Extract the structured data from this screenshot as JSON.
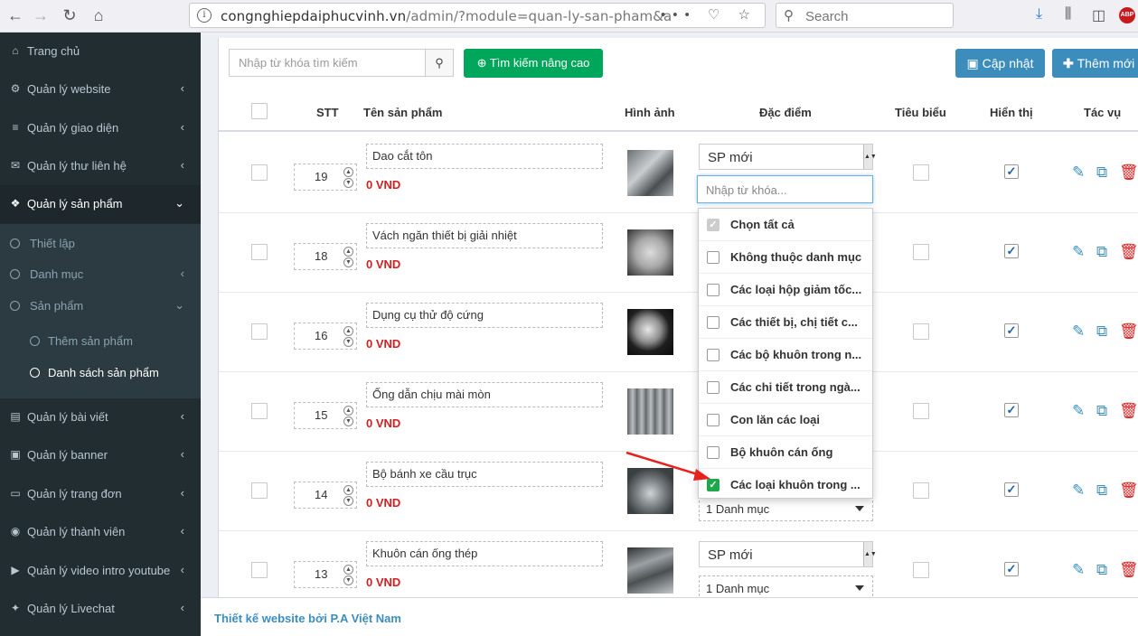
{
  "browser": {
    "url_domain": "congnghiepdaiphucvinh.vn",
    "url_path": "/admin/?module=quan-ly-san-pham&action=",
    "search_placeholder": "Search",
    "url_tools": "••• ♡ ☆"
  },
  "sidebar": {
    "items": [
      {
        "label": "Trang chủ",
        "icon": "home-icon",
        "glyph": "⌂"
      },
      {
        "label": "Quản lý website",
        "icon": "cogs-icon",
        "glyph": "⚙",
        "chevron": "‹"
      },
      {
        "label": "Quản lý giao diện",
        "icon": "bars-icon",
        "glyph": "≡",
        "chevron": "‹"
      },
      {
        "label": "Quản lý thư liên hệ",
        "icon": "envelope-icon",
        "glyph": "✉",
        "chevron": "‹"
      },
      {
        "label": "Quản lý sản phẩm",
        "icon": "cubes-icon",
        "glyph": "❖",
        "chevron": "⌄"
      },
      {
        "label": "Quản lý bài viết",
        "icon": "newspaper-icon",
        "glyph": "▤",
        "chevron": "‹"
      },
      {
        "label": "Quản lý banner",
        "icon": "image-icon",
        "glyph": "▣",
        "chevron": "‹"
      },
      {
        "label": "Quản lý trang đơn",
        "icon": "laptop-icon",
        "glyph": "▭",
        "chevron": "‹"
      },
      {
        "label": "Quản lý thành viên",
        "icon": "user-circle-icon",
        "glyph": "◉",
        "chevron": "‹"
      },
      {
        "label": "Quản lý video intro youtube",
        "icon": "youtube-icon",
        "glyph": "▶",
        "chevron": "‹"
      },
      {
        "label": "Quản lý Livechat",
        "icon": "comments-icon",
        "glyph": "✦",
        "chevron": "‹"
      }
    ],
    "submenu": [
      {
        "label": "Thiết lập"
      },
      {
        "label": "Danh mục",
        "chevron": "‹"
      },
      {
        "label": "Sản phẩm",
        "chevron": "⌄"
      },
      {
        "label": "Thêm sản phẩm"
      },
      {
        "label": "Danh sách sản phẩm"
      }
    ]
  },
  "toolbar": {
    "search_placeholder": "Nhập từ khóa tìm kiếm",
    "advanced_search": "Tìm kiếm nâng cao",
    "update": "Cập nhật",
    "add_new": "Thêm mới"
  },
  "table": {
    "headers": {
      "stt": "STT",
      "name": "Tên sản phẩm",
      "image": "Hình ảnh",
      "features": "Đặc điểm",
      "featured": "Tiêu biểu",
      "visible": "Hiển thị",
      "actions": "Tác vụ"
    },
    "rows": [
      {
        "stt": "19",
        "name": "Dao cắt tôn",
        "price": "0 VND",
        "feature": "SP mới",
        "category": "",
        "visible": true
      },
      {
        "stt": "18",
        "name": "Vách ngăn thiết bị giải nhiệt",
        "price": "0 VND",
        "feature": "",
        "category": "",
        "visible": true
      },
      {
        "stt": "16",
        "name": "Dụng cụ thử độ cứng",
        "price": "0 VND",
        "feature": "",
        "category": "",
        "visible": true
      },
      {
        "stt": "15",
        "name": "Ống dẫn chịu mài mòn",
        "price": "0 VND",
        "feature": "",
        "category": "",
        "visible": true
      },
      {
        "stt": "14",
        "name": "Bộ bánh xe cầu trục",
        "price": "0 VND",
        "feature": "",
        "category": "1 Danh mục",
        "visible": true
      },
      {
        "stt": "13",
        "name": "Khuôn cán ống thép",
        "price": "0 VND",
        "feature": "SP mới",
        "category": "1 Danh mục",
        "visible": true
      }
    ]
  },
  "dropdown": {
    "search_placeholder": "Nhập từ khóa...",
    "items": [
      {
        "label": "Chọn tất cả",
        "state": "grey"
      },
      {
        "label": "Không thuộc danh mục",
        "state": "off"
      },
      {
        "label": "Các loại hộp giảm tốc...",
        "state": "off"
      },
      {
        "label": "Các thiết bị, chị tiết c...",
        "state": "off"
      },
      {
        "label": "Các bộ khuôn trong n...",
        "state": "off"
      },
      {
        "label": "Các chi tiết trong ngà...",
        "state": "off"
      },
      {
        "label": "Con lăn các loại",
        "state": "off"
      },
      {
        "label": "Bộ khuôn cán ống",
        "state": "off"
      },
      {
        "label": "Các loại khuôn trong ...",
        "state": "on"
      }
    ]
  },
  "footer": {
    "text": "Thiết kế website bởi P.A Việt Nam"
  },
  "colors": {
    "sidebar": "#222d32",
    "primary": "#3c8dbc",
    "success": "#00a65a",
    "danger": "#dd1c1c",
    "price": "#d31f1f",
    "annotation_arrow": "#e8201e"
  }
}
